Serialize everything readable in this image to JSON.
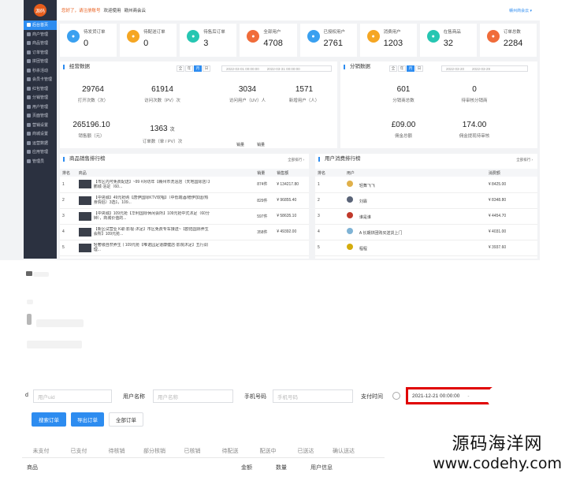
{
  "sidebar": {
    "logo": "源码",
    "items": [
      {
        "label": "后台首页",
        "active": true
      },
      {
        "label": "商户管理"
      },
      {
        "label": "商品管理"
      },
      {
        "label": "订单管理"
      },
      {
        "label": "拼团管理"
      },
      {
        "label": "秒杀活动"
      },
      {
        "label": "会员卡管理"
      },
      {
        "label": "红包管理"
      },
      {
        "label": "分销管理"
      },
      {
        "label": "用户管理"
      },
      {
        "label": "页面管理"
      },
      {
        "label": "营销设置"
      },
      {
        "label": "商城设置"
      },
      {
        "label": "运营数据"
      },
      {
        "label": "应用管理"
      },
      {
        "label": "管理员"
      }
    ]
  },
  "topbar": {
    "warn": "您好了，请注册账号",
    "welcome": "欢迎使用",
    "store": "赣州商会云",
    "right": "赣州商会云 ▾"
  },
  "stats": [
    {
      "label": "待发货订单",
      "value": "0",
      "color": "#3aa0f0",
      "icon": "truck-icon"
    },
    {
      "label": "待配送订单",
      "value": "0",
      "color": "#f5a623",
      "icon": "box-icon"
    },
    {
      "label": "待售后订单",
      "value": "3",
      "color": "#26c6b2",
      "icon": "service-icon"
    },
    {
      "label": "全部用户",
      "value": "4708",
      "color": "#f06c3a",
      "icon": "users-icon"
    },
    {
      "label": "已授权用户",
      "value": "2761",
      "color": "#3aa0f0",
      "icon": "user-check-icon"
    },
    {
      "label": "消费用户",
      "value": "1203",
      "color": "#f5a623",
      "icon": "cart-icon"
    },
    {
      "label": "在售商品",
      "value": "32",
      "color": "#26c6b2",
      "icon": "goods-icon"
    },
    {
      "label": "订单总数",
      "value": "2284",
      "color": "#f06c3a",
      "icon": "order-icon"
    }
  ],
  "ops": {
    "title": "经营数据",
    "segs": [
      "全",
      "年",
      "月",
      "日"
    ],
    "date_from": "2022-03-01 00:00:00",
    "date_to": "2022-03-31 00:00:00",
    "metrics": [
      {
        "value": "29764",
        "label": "打开次数（次）"
      },
      {
        "value": "61914",
        "label": "访问次数（PV）次"
      },
      {
        "value": "3034",
        "label": "访问用户（UV）人"
      },
      {
        "value": "1571",
        "label": "新增用户（人）"
      },
      {
        "value": "265196.10",
        "label": "销售额（元）"
      },
      {
        "value": "1363",
        "unit": "次",
        "label": "订单数（单 / PV）次"
      }
    ]
  },
  "dist": {
    "title": "分销数据",
    "segs": [
      "全",
      "年",
      "月",
      "日"
    ],
    "date_from": "2022-03-20",
    "date_to": "2022-03-29",
    "metrics": [
      {
        "value": "601",
        "label": "分销商总数"
      },
      {
        "value": "0",
        "label": "待审核分销商"
      },
      {
        "value": "£09.00",
        "label": "佣金总额"
      },
      {
        "value": "174.00",
        "label": "佣金提现待审核"
      }
    ]
  },
  "rank_goods": {
    "title": "商品销售排行榜",
    "more": "全部排行 ›",
    "tabs": [
      "销量",
      "销量"
    ],
    "cols": [
      "排名",
      "商品",
      "销量",
      "销售额"
    ],
    "rows": [
      {
        "rank": "1",
        "name": "【市区内可免费配送】~99 #对坊年【赣州市洗浴店（天地国际店）】鹏城·浴足（60...",
        "qty": "874件",
        "amount": "¥ 134217.80"
      },
      {
        "rank": "2",
        "name": "【中央城】49元抢购【唐伊国际KTV欢唱】（中低端酒/赠伊加运/热身情侣）3选1，109...",
        "qty": "829件",
        "amount": "¥ 96855.40"
      },
      {
        "rank": "3",
        "name": "【中央城】109元抢【华利国际休闲会所】109元抢中式沐足（60分钟），商城价值的...",
        "qty": "597件",
        "amount": "¥ 58635.10"
      },
      {
        "rank": "4",
        "name": "【新区试营业 K歌·影视·沐足】市区免费专车接送~【欧陆国际养生会所】109元抢...",
        "qty": "358件",
        "amount": "¥ 49392.00"
      },
      {
        "rank": "5",
        "name": "轻奢级自然养生丨109元抢【唯诺园足道康健店·影院沐足】五行调理...",
        "qty": "",
        "amount": ""
      }
    ]
  },
  "rank_users": {
    "title": "用户消费排行榜",
    "more": "全部排行 ›",
    "cols": [
      "排名",
      "用户",
      "消费额"
    ],
    "rows": [
      {
        "rank": "1",
        "name": "轻舞飞飞",
        "amount": "¥ 8425.00",
        "color": "#e0b04a"
      },
      {
        "rank": "2",
        "name": "刘霖",
        "amount": "¥ 8348.80",
        "color": "#5a6478"
      },
      {
        "rank": "3",
        "name": "谁是谁",
        "amount": "¥ 4454.70",
        "color": "#c0392b"
      },
      {
        "rank": "4",
        "name": "A 长期拼团购买送货上门",
        "amount": "¥ 4031.00",
        "color": "#7fb3d5"
      },
      {
        "rank": "5",
        "name": "程程",
        "amount": "¥ 3937.60",
        "color": "#d4ac0d"
      }
    ]
  },
  "search": {
    "order_no_label": "d",
    "order_no_placeholder": "用户uid",
    "username_label": "用户名称",
    "username_placeholder": "用户名称",
    "phone_label": "手机号码",
    "phone_placeholder": "手机号码",
    "paytime_label": "支付时间",
    "paytime_value": "2021-12-21 00:00:00",
    "btn_search": "搜索订单",
    "btn_export": "导出订单",
    "btn_all": "全部订单"
  },
  "order_tabs": [
    "未支付",
    "已支付",
    "待核销",
    "部分核销",
    "已核销",
    "待配送",
    "配送中",
    "已送达",
    "确认送达"
  ],
  "order_cols": [
    "商品",
    "金额",
    "数量",
    "用户信息"
  ],
  "watermark": {
    "line1": "源码海洋网",
    "line2": "www.codehy.com"
  },
  "colors": {
    "accent": "#2d8cf0",
    "sidebar": "#2b3140",
    "highlight": "#e00000"
  }
}
